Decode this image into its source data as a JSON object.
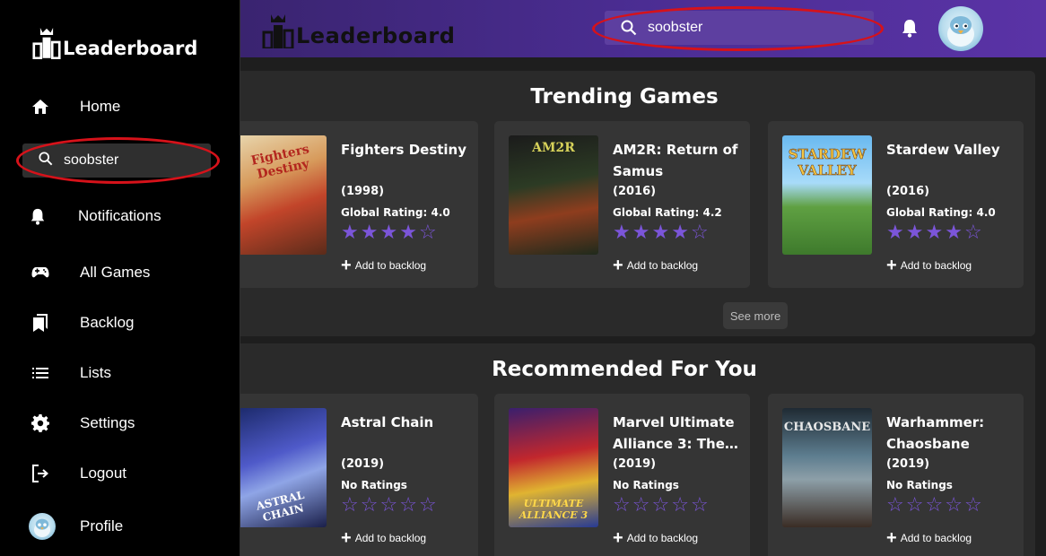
{
  "app": {
    "logo_text": "Leaderboard"
  },
  "header": {
    "search": {
      "value": "soobster",
      "placeholder": "Search"
    }
  },
  "sidebar": {
    "logo_text": "Leaderboard",
    "search_value": "soobster",
    "items": [
      {
        "label": "Home",
        "icon": "home-icon"
      },
      {
        "label": "Notifications",
        "icon": "bell-icon"
      },
      {
        "label": "All Games",
        "icon": "gamepad-icon"
      },
      {
        "label": "Backlog",
        "icon": "bookmark-icon"
      },
      {
        "label": "Lists",
        "icon": "list-icon"
      },
      {
        "label": "Settings",
        "icon": "gear-icon"
      },
      {
        "label": "Logout",
        "icon": "logout-icon"
      },
      {
        "label": "Profile",
        "icon": "avatar"
      }
    ]
  },
  "trending": {
    "title": "Trending Games",
    "see_more": "See more",
    "games": [
      {
        "title": "Fighters Destiny",
        "year": "(1998)",
        "rating": "Global Rating: 4.0",
        "stars": 4,
        "backlog": "Add to backlog",
        "cover_text": "Fighters Destiny"
      },
      {
        "title": "AM2R: Return of Samus",
        "year": "(2016)",
        "rating": "Global Rating: 4.2",
        "stars": 4,
        "backlog": "Add to backlog",
        "cover_text": "AM2R"
      },
      {
        "title": "Stardew Valley",
        "year": "(2016)",
        "rating": "Global Rating: 4.0",
        "stars": 4,
        "backlog": "Add to backlog",
        "cover_text": "STARDEW VALLEY"
      }
    ]
  },
  "recommended": {
    "title": "Recommended For You",
    "games": [
      {
        "title": "Astral Chain",
        "year": "(2019)",
        "rating": "No Ratings",
        "stars": 0,
        "backlog": "Add to backlog",
        "cover_text": "ASTRAL CHAIN"
      },
      {
        "title": "Marvel Ultimate Alliance 3: The…",
        "year": "(2019)",
        "rating": "No Ratings",
        "stars": 0,
        "backlog": "Add to backlog",
        "cover_text": "ULTIMATE ALLIANCE 3"
      },
      {
        "title": "Warhammer: Chaosbane",
        "year": "(2019)",
        "rating": "No Ratings",
        "stars": 0,
        "backlog": "Add to backlog",
        "cover_text": "CHAOSBANE"
      }
    ]
  },
  "colors": {
    "accent": "#7b55d9",
    "topbar": "#4b2d93",
    "highlight_ring": "#d6121a",
    "card": "#353535"
  }
}
